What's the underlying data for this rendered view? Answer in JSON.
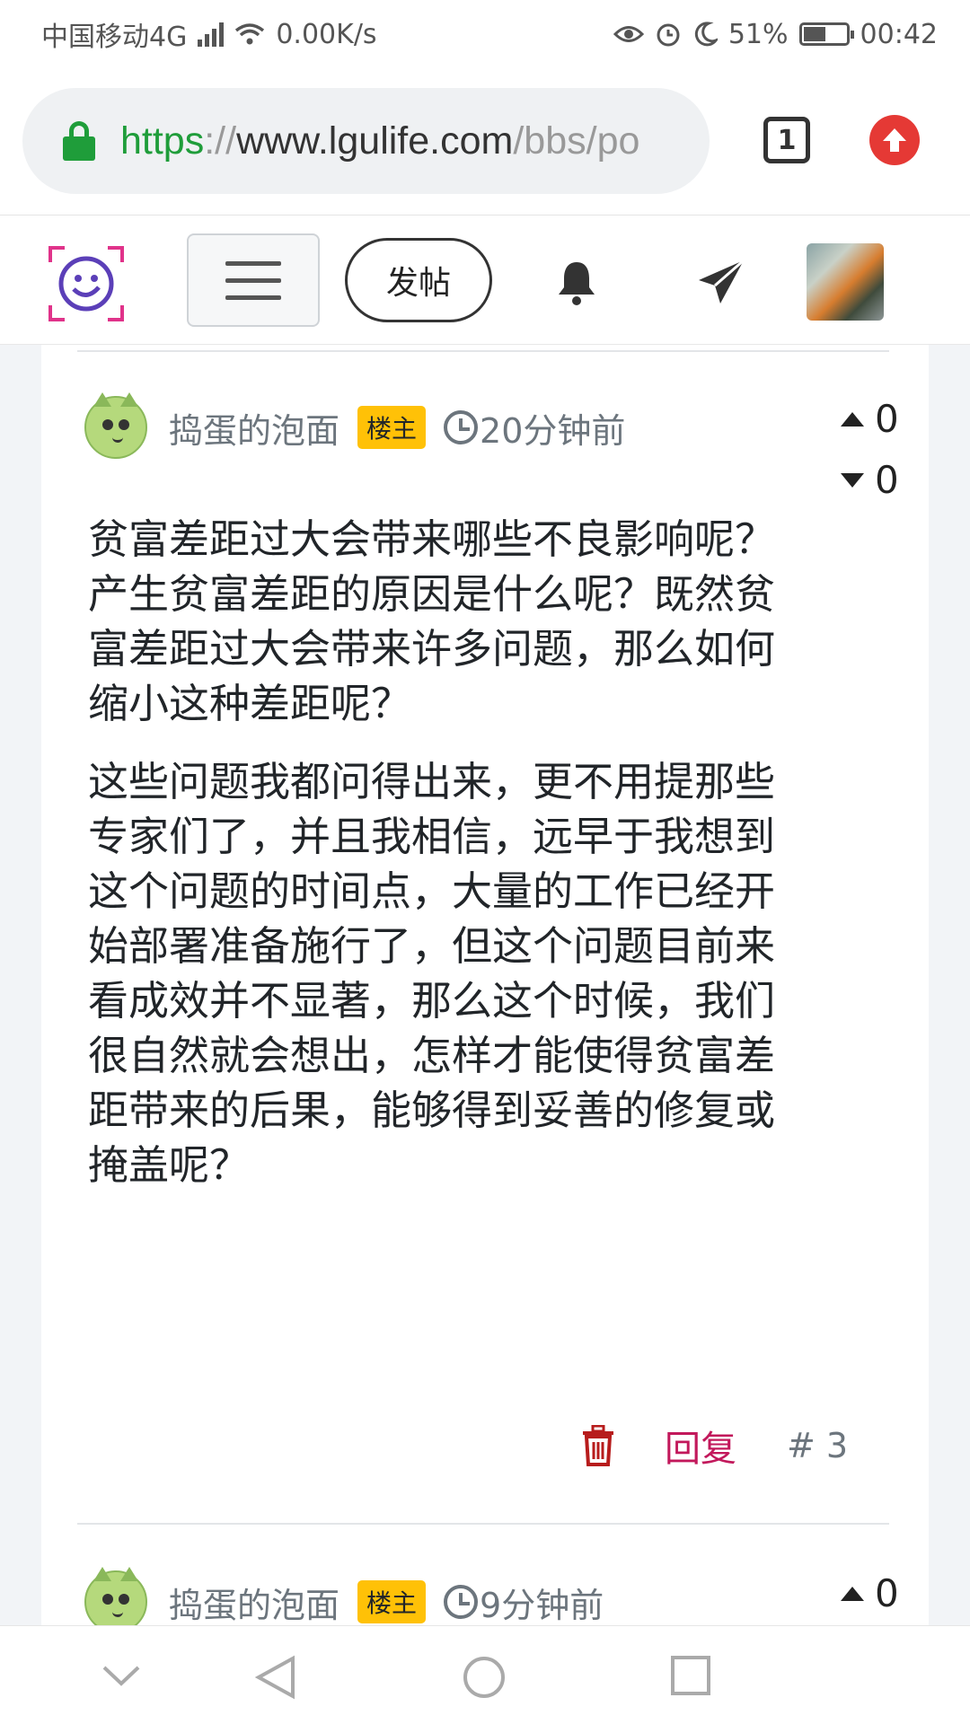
{
  "status_bar": {
    "carrier": "中国移动4G",
    "network_tag": "4G",
    "speed": "0.00K/s",
    "battery": "51%",
    "time": "00:42"
  },
  "browser": {
    "url_scheme": "https",
    "url_sep": "://",
    "url_host": "www.lgulife.com",
    "url_path": "/bbs/po",
    "tab_count": "1"
  },
  "header": {
    "post_button": "发帖"
  },
  "posts": [
    {
      "author": "捣蛋的泡面",
      "badge": "楼主",
      "time": "20分钟前",
      "upvotes": "0",
      "downvotes": "0",
      "paragraphs": [
        "贫富差距过大会带来哪些不良影响呢？产生贫富差距的原因是什么呢？既然贫富差距过大会带来许多问题，那么如何缩小这种差距呢？",
        "这些问题我都问得出来，更不用提那些专家们了，并且我相信，远早于我想到这个问题的时间点，大量的工作已经开始部署准备施行了，但这个问题目前来看成效并不显著，那么这个时候，我们很自然就会想出，怎样才能使得贫富差距带来的后果，能够得到妥善的修复或掩盖呢？"
      ],
      "reply_label": "回复",
      "floor": "# 3"
    },
    {
      "author": "捣蛋的泡面",
      "badge": "楼主",
      "time": "9分钟前",
      "upvotes": "0"
    }
  ],
  "colors": {
    "accent_green": "#1f9d3a",
    "badge_yellow": "#ffc107",
    "reply_pink": "#c2185b",
    "trash_red": "#b71c1c",
    "upload_red": "#e53935"
  }
}
